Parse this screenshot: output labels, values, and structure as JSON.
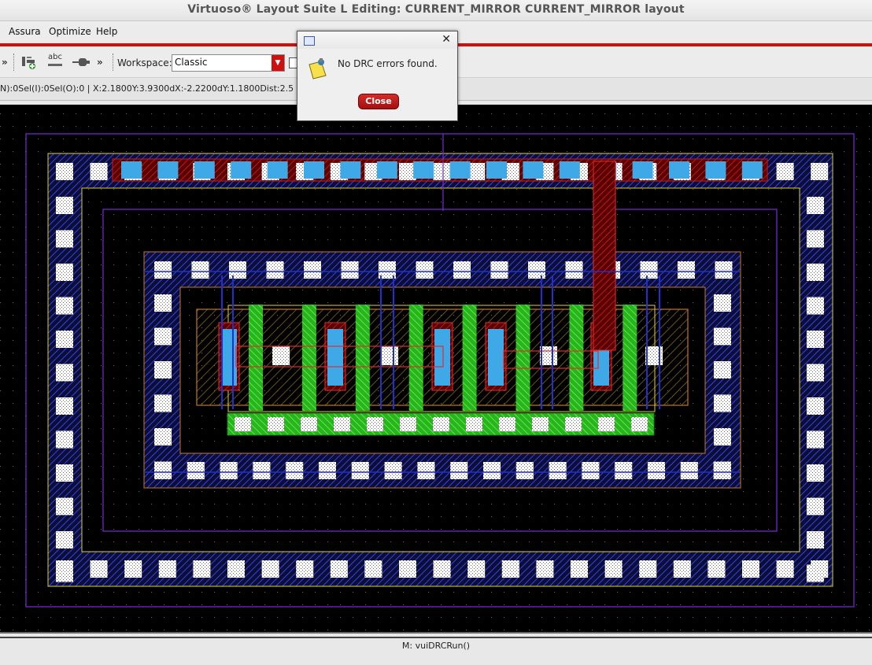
{
  "window": {
    "title": "Virtuoso® Layout Suite L Editing: CURRENT_MIRROR CURRENT_MIRROR layout"
  },
  "menu": {
    "items": [
      "Assura",
      "Optimize",
      "Help"
    ]
  },
  "toolbar": {
    "overflow_left": "»",
    "overflow_right": "»",
    "text_icon_label": "abc",
    "workspace_label": "Workspace:",
    "workspace_value": "Classic"
  },
  "status": {
    "text": "N):0Sel(I):0Sel(O):0 | X:2.1800Y:3.9300dX:-2.2200dY:1.1800Dist:2.5"
  },
  "bottom": {
    "message": "M: vuiDRCRun()"
  },
  "dialog": {
    "message": "No DRC errors found.",
    "close_label": "Close",
    "close_x": "✕"
  },
  "colors": {
    "accent_red": "#cc1111",
    "canvas_bg": "#000000",
    "poly_green": "#2ec41f",
    "contact_blue": "#3fa9e8",
    "nwell_purple": "#7a2bd6",
    "metal_blue": "#1f2fd1",
    "diff_orange": "#c27a1a",
    "outline_yellow": "#e0d025"
  }
}
